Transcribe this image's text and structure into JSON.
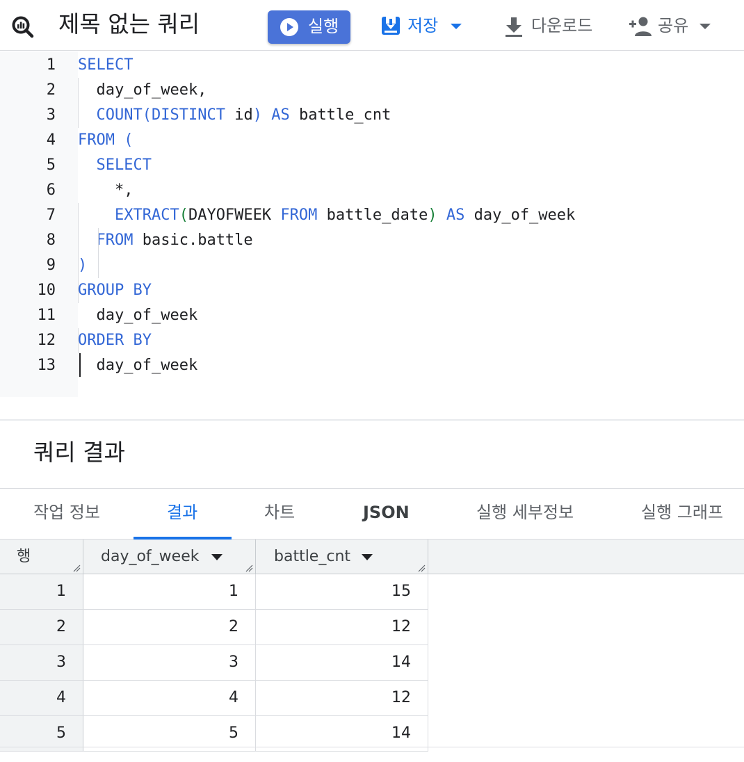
{
  "toolbar": {
    "title": "제목 없는 쿼리",
    "run_label": "실행",
    "save_label": "저장",
    "download_label": "다운로드",
    "share_label": "공유"
  },
  "editor": {
    "line_numbers": [
      "1",
      "2",
      "3",
      "4",
      "5",
      "6",
      "7",
      "8",
      "9",
      "10",
      "11",
      "12",
      "13"
    ],
    "lines": [
      [
        [
          "kw",
          "SELECT"
        ]
      ],
      [
        [
          "",
          "  day_of_week,"
        ]
      ],
      [
        [
          "",
          "  "
        ],
        [
          "fn",
          "COUNT"
        ],
        [
          "pb",
          "("
        ],
        [
          "kw",
          "DISTINCT"
        ],
        [
          "",
          " id"
        ],
        [
          "pb",
          ")"
        ],
        [
          "",
          " "
        ],
        [
          "kw",
          "AS"
        ],
        [
          "",
          " battle_cnt"
        ]
      ],
      [
        [
          "kw",
          "FROM"
        ],
        [
          "",
          " "
        ],
        [
          "pb",
          "("
        ]
      ],
      [
        [
          "",
          "  "
        ],
        [
          "kw",
          "SELECT"
        ]
      ],
      [
        [
          "",
          "    *,"
        ]
      ],
      [
        [
          "",
          "    "
        ],
        [
          "fn",
          "EXTRACT"
        ],
        [
          "pg",
          "("
        ],
        [
          "",
          "DAYOFWEEK "
        ],
        [
          "kw",
          "FROM"
        ],
        [
          "",
          " battle_date"
        ],
        [
          "pg",
          ")"
        ],
        [
          "",
          " "
        ],
        [
          "kw",
          "AS"
        ],
        [
          "",
          " day_of_week"
        ]
      ],
      [
        [
          "",
          "  "
        ],
        [
          "kw",
          "FROM"
        ],
        [
          "",
          " basic.battle"
        ]
      ],
      [
        [
          "pb",
          ")"
        ]
      ],
      [
        [
          "kw",
          "GROUP BY"
        ]
      ],
      [
        [
          "",
          "  day_of_week"
        ]
      ],
      [
        [
          "kw",
          "ORDER BY"
        ]
      ],
      [
        [
          "",
          "  day_of_week"
        ]
      ]
    ]
  },
  "results": {
    "title": "쿼리 결과",
    "tabs": [
      {
        "label": "작업 정보"
      },
      {
        "label": "결과",
        "active": true
      },
      {
        "label": "차트"
      },
      {
        "label": "JSON"
      },
      {
        "label": "실행 세부정보"
      },
      {
        "label": "실행 그래프"
      }
    ],
    "columns": [
      "행",
      "day_of_week",
      "battle_cnt"
    ],
    "rows": [
      [
        "1",
        "1",
        "15"
      ],
      [
        "2",
        "2",
        "12"
      ],
      [
        "3",
        "3",
        "14"
      ],
      [
        "4",
        "4",
        "12"
      ],
      [
        "5",
        "5",
        "14"
      ]
    ]
  },
  "colors": {
    "accent": "#1a73e8",
    "run_button": "#4a73d8",
    "keyword": "#3367d6",
    "paren_green": "#188038"
  },
  "icons": {
    "logo": "bigquery-icon",
    "run": "play-circle-icon",
    "save": "save-icon",
    "download": "download-icon",
    "share": "person-add-icon"
  }
}
